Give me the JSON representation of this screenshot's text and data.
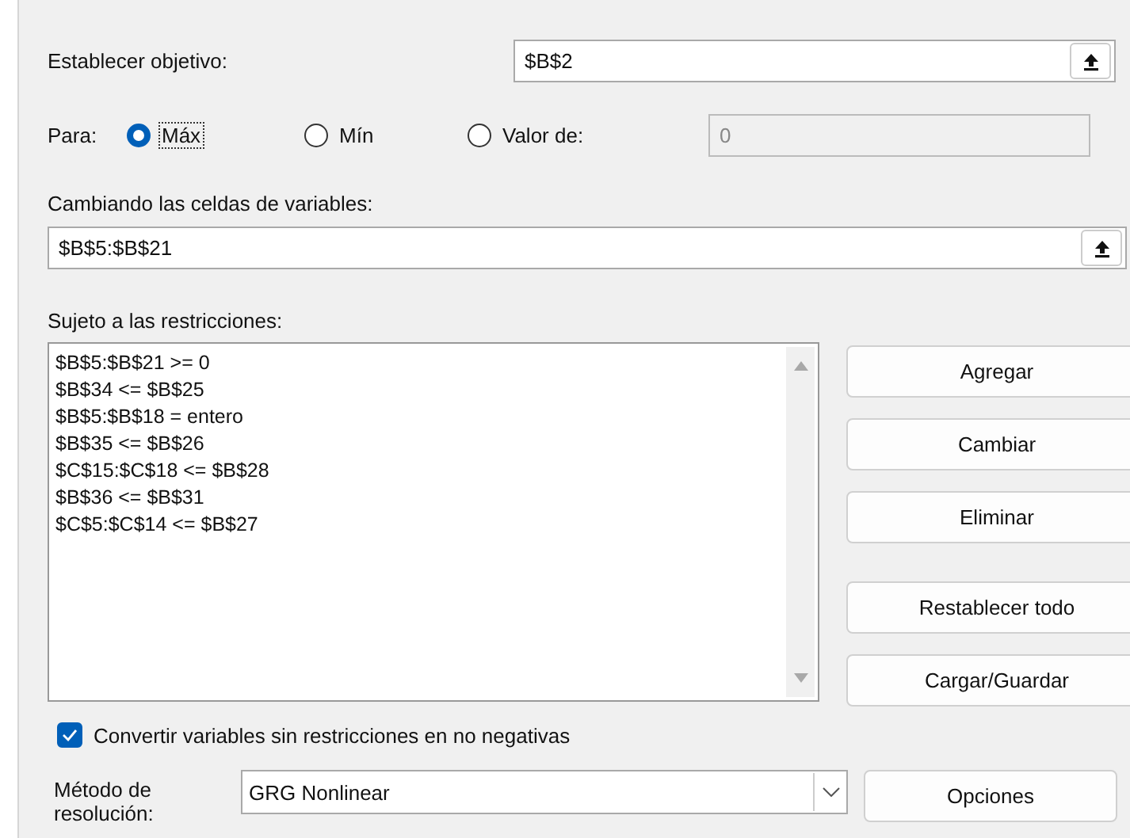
{
  "objective": {
    "label": "Establecer objetivo:",
    "value": "$B$2"
  },
  "goal": {
    "label": "Para:",
    "options": [
      {
        "label": "Máx",
        "selected": true,
        "focused": true
      },
      {
        "label": "Mín",
        "selected": false,
        "focused": false
      },
      {
        "label": "Valor de:",
        "selected": false,
        "focused": false
      }
    ],
    "value_field": {
      "value": "0",
      "disabled": true
    }
  },
  "variables": {
    "label": "Cambiando las celdas de variables:",
    "value": "$B$5:$B$21"
  },
  "constraints": {
    "label": "Sujeto a las restricciones:",
    "items": [
      "$B$5:$B$21 >= 0",
      "$B$34 <= $B$25",
      "$B$5:$B$18 = entero",
      "$B$35 <= $B$26",
      "$C$15:$C$18 <= $B$28",
      "$B$36 <= $B$31",
      "$C$5:$C$14 <= $B$27"
    ]
  },
  "constraint_buttons": [
    "Agregar",
    "Cambiar",
    "Eliminar"
  ],
  "model_buttons": [
    "Restablecer todo",
    "Cargar/Guardar"
  ],
  "nonnegative": {
    "label": "Convertir variables sin restricciones en no negativas",
    "checked": true
  },
  "method": {
    "label": "Método de resolución:",
    "value": "GRG Nonlinear",
    "button": "Opciones"
  }
}
